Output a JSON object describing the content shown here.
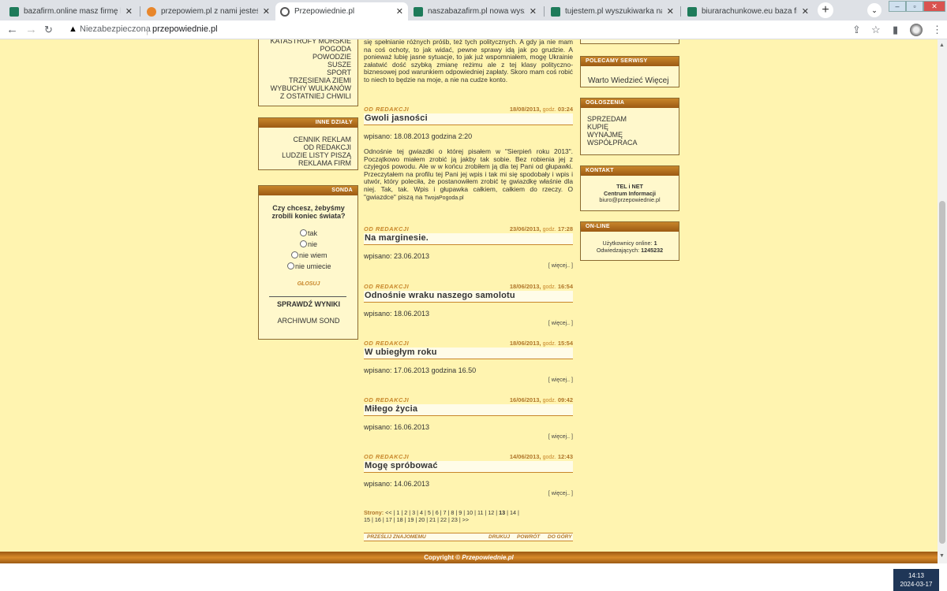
{
  "browser": {
    "tabs": [
      {
        "title": "bazafirm.online masz firmę kup",
        "icon": "green-square-icon"
      },
      {
        "title": "przepowiem.pl z nami jesteś zna",
        "icon": "orange-flame-icon"
      },
      {
        "title": "Przepowiednie.pl",
        "icon": "globe-icon"
      },
      {
        "title": "naszabazafirm.pl nowa wyszuki",
        "icon": "green-square-icon"
      },
      {
        "title": "tujestem.pl wyszukiwarka naj",
        "icon": "green-square-icon"
      },
      {
        "title": "biurarachunkowe.eu baza firm k",
        "icon": "green-square-icon"
      }
    ],
    "close_glyph": "✕",
    "new_tab": "+",
    "not_secure": "Niezabezpieczona",
    "url": "przepowiednie.pl"
  },
  "left": {
    "kategorie": [
      "KATASTROFY MORSKIE",
      "POGODA",
      "POWODZIE",
      "SUSZE",
      "SPORT",
      "TRZĘSIENIA ZIEMI",
      "WYBUCHY WULKANÓW",
      "Z OSTATNIEJ CHWILI"
    ],
    "inne_title": "INNE DZIAŁY",
    "inne": [
      "CENNIK REKLAM",
      "OD REDAKCJI",
      "LUDZIE LISTY PISZĄ",
      "REKLAMA FIRM"
    ],
    "sonda_title": "SONDA",
    "sonda_q": "Czy chcesz, żebyśmy zrobili koniec świata?",
    "sonda_options": [
      "tak",
      "nie",
      "nie wiem",
      "nie umiecie"
    ],
    "glosuj": "GŁOSUJ",
    "sprawdz": "SPRAWDŹ WYNIKI",
    "archiwum": "ARCHIWUM SOND"
  },
  "center": {
    "intro": "się spełnianie różnych próśb, też tych politycznych. A gdy ja nie mam na coś ochoty, to jak widać, pewne sprawy idą jak po grudzie. A ponieważ lubię jasne sytuacje, to jak już wspomniałem, mogę Ukrainie załatwić dość szybką zmianę reżimu ale z tej klasy polityczno-biznesowej pod warunkiem odpowiedniej zapłaty. Skoro mam coś robić to niech to będzie na moje, a nie na cudze konto.",
    "articles": [
      {
        "cat": "OD REDAKCJI",
        "date": "18/08/2013,",
        "godz": "godz.",
        "time": "03:24",
        "title": "Gwoli jasności",
        "wp": "wpisano: 18.08.2013 godzina 2:20",
        "body": "Odnośnie tej gwiazdki o której pisałem w \"Sierpień roku 2013\". Początkowo miałem zrobić ją jakby tak sobie. Bez robienia jej z czyjegoś powodu. Ale w w końcu zrobiłem ją dla tej Pani od głupawki. Przeczytałem na profilu tej Pani jej wpis i tak mi się spodobały i wpis i utwór, który poleciła, że postanowiłem zrobić tę gwiazdkę właśnie dla niej. Tak, tak. Wpis i głupawka całkiem, całkiem do rzeczy. O \"gwiazdce\" piszą na",
        "body_link": "TwojaPogoda.pl"
      },
      {
        "cat": "OD REDAKCJI",
        "date": "23/06/2013,",
        "godz": "godz.",
        "time": "17:28",
        "title": "Na marginesie.",
        "wp": "wpisano: 23.06.2013",
        "more": "[ więcej.. ]"
      },
      {
        "cat": "OD REDAKCJI",
        "date": "18/06/2013,",
        "godz": "godz.",
        "time": "16:54",
        "title": "Odnośnie wraku naszego samolotu",
        "wp": "wpisano: 18.06.2013",
        "more": "[ więcej.. ]"
      },
      {
        "cat": "OD REDAKCJI",
        "date": "18/06/2013,",
        "godz": "godz.",
        "time": "15:54",
        "title": "W ubiegłym roku",
        "wp": "wpisano: 17.06.2013 godzina 16.50",
        "more": "[ więcej.. ]"
      },
      {
        "cat": "OD REDAKCJI",
        "date": "16/06/2013,",
        "godz": "godz.",
        "time": "09:42",
        "title": "Miłego życia",
        "wp": "wpisano: 16.06.2013",
        "more": "[ więcej.. ]"
      },
      {
        "cat": "OD REDAKCJI",
        "date": "14/06/2013,",
        "godz": "godz.",
        "time": "12:43",
        "title": "Mogę spróbować",
        "wp": "wpisano: 14.06.2013",
        "more": "[ więcej.. ]"
      }
    ],
    "strony_label": "Strony:",
    "pages_line1": "<< | 1 | 2 | 3 | 4 | 5 | 6 | 7 | 8 | 9 | 10 | 11 | 12 | ",
    "current_page": "13",
    "pages_line1b": " | 14 |",
    "pages_line2": "15 | 16 | 17 | 18 | 19 | 20 | 21 | 22 | 23 | >>",
    "przeslij": "PRZEŚLIJ ZNAJOMEMU",
    "drukuj": "DRUKUJ",
    "powrot": "POWRÓT",
    "do_gory": "DO GÓRY"
  },
  "right": {
    "polecamy_title": "POLECAMY SERWISY",
    "polecamy_item": "Warto Wiedzieć Więcej",
    "ogloszenia_title": "OGŁOSZENIA",
    "ogloszenia": [
      "SPRZEDAM",
      "KUPIĘ",
      "WYNAJMĘ",
      "WSPÓŁPRACA"
    ],
    "kontakt_title": "KONTAKT",
    "kontakt_l1": "TEL i NET",
    "kontakt_l2": "Centrum Informacji",
    "kontakt_l3": "biuro@przepowiednie.pl",
    "online_title": "ON-LINE",
    "online_users_label": "Użytkownicy online:",
    "online_users": "1",
    "visits_label": "Odwiedzających:",
    "visits": "1245232"
  },
  "footer": {
    "copyright": "Copyright ©",
    "brand": "Przepowiednie.pl"
  },
  "clock": {
    "time": "14:13",
    "date": "2024-03-17"
  }
}
